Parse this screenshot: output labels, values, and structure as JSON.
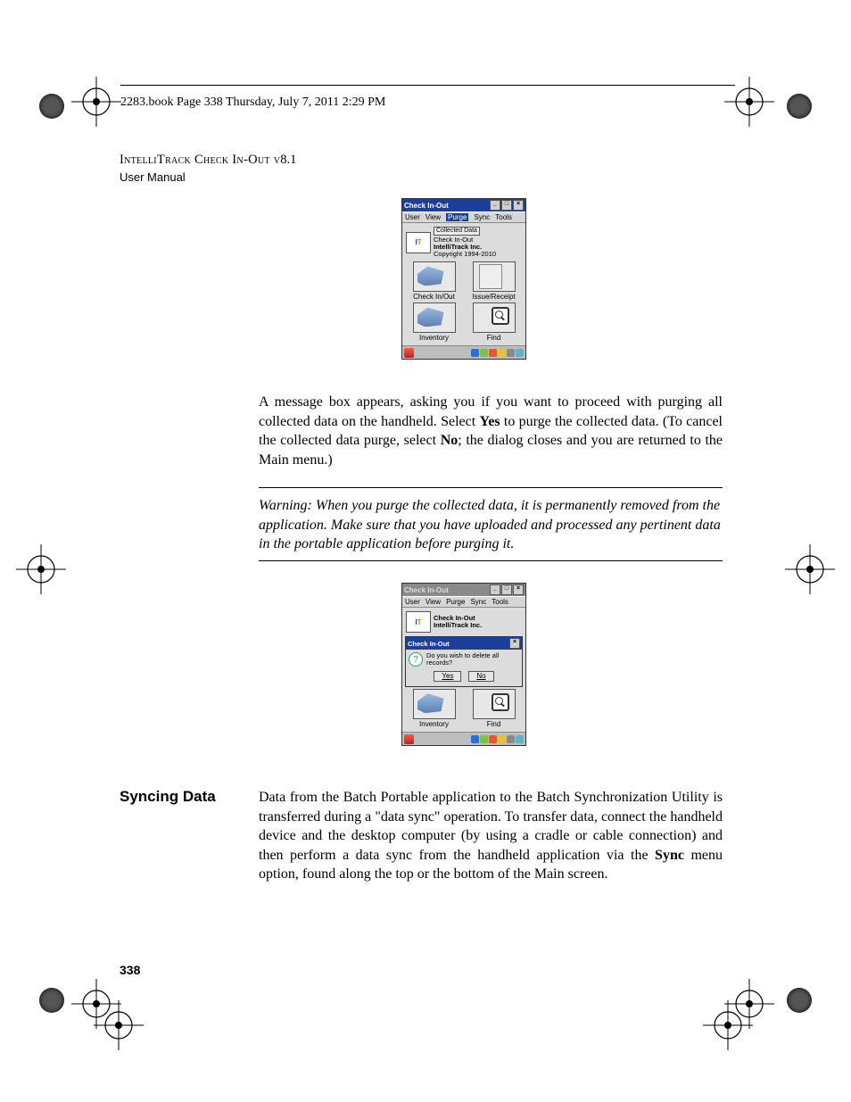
{
  "header": {
    "text": "2283.book  Page 338  Thursday, July 7, 2011  2:29 PM"
  },
  "title": {
    "line1_sc": "IntelliTrack Check In-Out v",
    "line1_ver": "8.1",
    "line2": "User Manual"
  },
  "figure1": {
    "title": "Check In-Out",
    "menu": [
      "User",
      "View",
      "Purge",
      "Sync",
      "Tools"
    ],
    "pill": "Collected Data",
    "brand_line1": "Check In-Out",
    "brand_line2": "IntelliTrack Inc.",
    "brand_line3": "Copyright 1994-2010",
    "cells": [
      "Check In/Out",
      "Issue/Receipt",
      "Inventory",
      "Find"
    ]
  },
  "para1": {
    "t1": "A message box appears, asking you if you want to proceed with purging all collected data on the handheld. Select ",
    "b1": "Yes",
    "t2": " to purge the collected data. (To cancel the collected data purge, select ",
    "b2": "No",
    "t3": "; the dialog closes and you are returned to the Main menu.)"
  },
  "warning": "Warning:   When you purge the collected data, it is permanently removed from the application. Make sure that you have uploaded and processed any pertinent data in the portable application before purging it.",
  "figure2": {
    "title": "Check In-Out",
    "menu": [
      "User",
      "View",
      "Purge",
      "Sync",
      "Tools"
    ],
    "brand_line1": "Check In-Out",
    "brand_line2": "IntelliTrack Inc.",
    "dialog_title": "Check In-Out",
    "dialog_msg": "Do you wish to delete all records?",
    "yes": "Yes",
    "no": "No",
    "cells": [
      "Inventory",
      "Find"
    ]
  },
  "section": {
    "head": "Syncing Data"
  },
  "para2": {
    "t1": "Data from the Batch Portable application to the Batch Synchronization Utility is transferred during a \"data sync\" operation. To transfer data, connect the handheld device and the desktop computer (by using a cradle or cable connection) and then perform a data sync from the handheld application via the ",
    "b1": "Sync",
    "t2": " menu option, found along the top or the bottom of the Main screen."
  },
  "page_number": "338"
}
